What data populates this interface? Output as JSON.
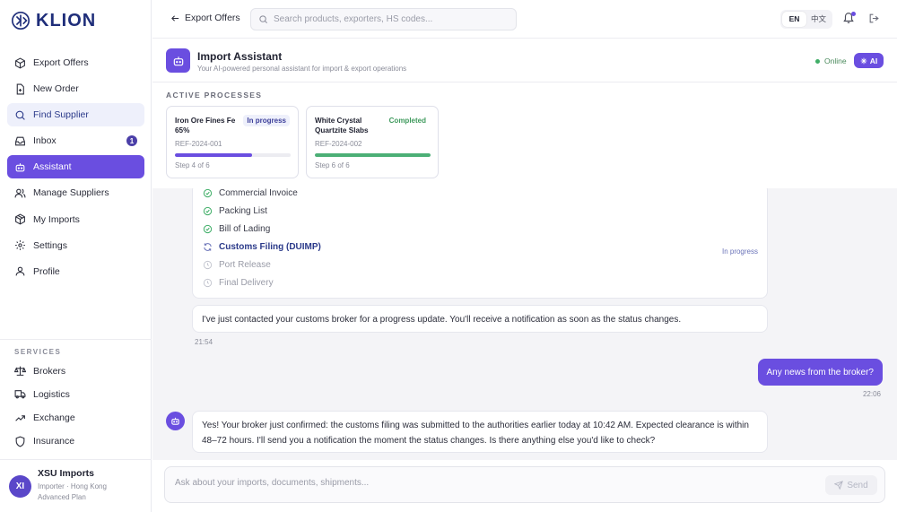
{
  "brand": {
    "name": "KLION"
  },
  "nav": {
    "items": [
      {
        "label": "Export Offers",
        "icon": "cube-icon",
        "state": "normal"
      },
      {
        "label": "New Order",
        "icon": "file-plus-icon",
        "state": "normal"
      },
      {
        "label": "Find Supplier",
        "icon": "search-icon",
        "state": "hover"
      },
      {
        "label": "Inbox",
        "icon": "inbox-icon",
        "state": "normal",
        "badge": "1"
      },
      {
        "label": "Assistant",
        "icon": "bot-icon",
        "state": "active"
      },
      {
        "label": "Manage Suppliers",
        "icon": "users-icon",
        "state": "normal"
      },
      {
        "label": "My Imports",
        "icon": "package-icon",
        "state": "normal"
      },
      {
        "label": "Settings",
        "icon": "gear-icon",
        "state": "normal"
      },
      {
        "label": "Profile",
        "icon": "user-icon",
        "state": "normal"
      }
    ]
  },
  "services": {
    "title": "SERVICES",
    "items": [
      {
        "label": "Brokers",
        "icon": "scale-icon"
      },
      {
        "label": "Logistics",
        "icon": "truck-icon"
      },
      {
        "label": "Exchange",
        "icon": "exchange-icon"
      },
      {
        "label": "Insurance",
        "icon": "shield-icon"
      }
    ]
  },
  "user": {
    "initials": "XI",
    "name": "XSU Imports",
    "role_location": "Importer · Hong Kong",
    "plan": "Advanced Plan"
  },
  "topbar": {
    "back_label": "Export Offers",
    "search_placeholder": "Search products, exporters, HS codes...",
    "lang_en": "EN",
    "lang_zh": "中文"
  },
  "assistant": {
    "title": "Import Assistant",
    "subtitle": "Your AI-powered personal assistant for import & export operations",
    "status": "Online",
    "badge": "AI"
  },
  "processes": {
    "title": "ACTIVE PROCESSES",
    "items": [
      {
        "name": "Iron Ore Fines Fe 65%",
        "status": "In progress",
        "ref": "REF-2024-001",
        "step": "Step 4 of 6",
        "progress": 0.67,
        "color": "#6a4ee0",
        "status_bg": "#eef0fb",
        "status_color": "#3d3f9a"
      },
      {
        "name": "White Crystal Quartzite Slabs",
        "status": "Completed",
        "ref": "REF-2024-002",
        "step": "Step 6 of 6",
        "progress": 1.0,
        "color": "#4caf76",
        "status_bg": "#ffffff",
        "status_color": "#3f9a5d"
      }
    ]
  },
  "chat": {
    "steps": [
      {
        "label": "Commercial Invoice",
        "state": "done"
      },
      {
        "label": "Packing List",
        "state": "done"
      },
      {
        "label": "Bill of Lading",
        "state": "done"
      },
      {
        "label": "Customs Filing (DUIMP)",
        "state": "current"
      },
      {
        "label": "Port Release",
        "state": "pending"
      },
      {
        "label": "Final Delivery",
        "state": "pending"
      }
    ],
    "current_tag": "In progress",
    "msg1": "I've just contacted your customs broker for a progress update. You'll receive a notification as soon as the status changes.",
    "time1": "21:54",
    "user_msg": "Any news from the broker?",
    "time2": "22:06",
    "msg2": "Yes! Your broker just confirmed: the customs filing was submitted to the authorities earlier today at 10:42 AM. Expected clearance is within 48–72 hours. I'll send you a notification the moment the status changes. Is there anything else you'd like to check?"
  },
  "composer": {
    "placeholder": "Ask about your imports, documents, shipments...",
    "send_label": "Send"
  }
}
